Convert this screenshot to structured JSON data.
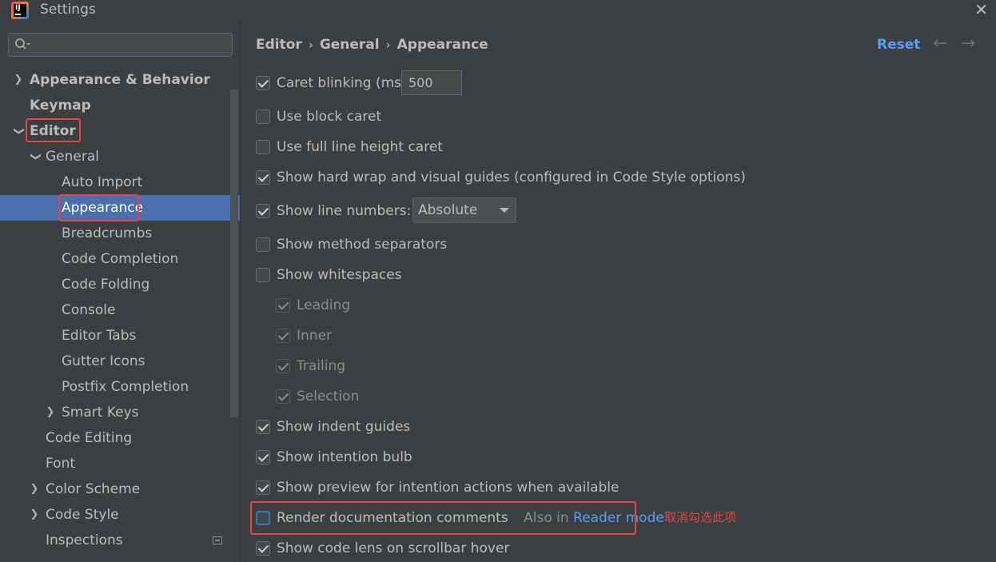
{
  "window": {
    "title": "Settings"
  },
  "search": {
    "placeholder": ""
  },
  "tree": [
    {
      "label": "Appearance & Behavior"
    },
    {
      "label": "Keymap"
    },
    {
      "label": "Editor"
    },
    {
      "label": "General"
    },
    {
      "label": "Auto Import"
    },
    {
      "label": "Appearance"
    },
    {
      "label": "Breadcrumbs"
    },
    {
      "label": "Code Completion"
    },
    {
      "label": "Code Folding"
    },
    {
      "label": "Console"
    },
    {
      "label": "Editor Tabs"
    },
    {
      "label": "Gutter Icons"
    },
    {
      "label": "Postfix Completion"
    },
    {
      "label": "Smart Keys"
    },
    {
      "label": "Code Editing"
    },
    {
      "label": "Font"
    },
    {
      "label": "Color Scheme"
    },
    {
      "label": "Code Style"
    },
    {
      "label": "Inspections"
    }
  ],
  "breadcrumb": [
    "Editor",
    "General",
    "Appearance"
  ],
  "toolbar": {
    "reset": "Reset"
  },
  "options": {
    "caret_blinking": {
      "label": "Caret blinking (ms):",
      "checked": true,
      "value": "500"
    },
    "block_caret": {
      "label": "Use block caret",
      "checked": false
    },
    "full_line_caret": {
      "label": "Use full line height caret",
      "checked": false
    },
    "hard_wrap": {
      "label": "Show hard wrap and visual guides (configured in Code Style options)",
      "checked": true
    },
    "line_numbers": {
      "label": "Show line numbers:",
      "checked": true,
      "value": "Absolute"
    },
    "method_separators": {
      "label": "Show method separators",
      "checked": false
    },
    "whitespaces": {
      "label": "Show whitespaces",
      "checked": false
    },
    "leading": {
      "label": "Leading",
      "checked": true
    },
    "inner": {
      "label": "Inner",
      "checked": true
    },
    "trailing": {
      "label": "Trailing",
      "checked": true
    },
    "selection": {
      "label": "Selection",
      "checked": true
    },
    "indent_guides": {
      "label": "Show indent guides",
      "checked": true
    },
    "intention_bulb": {
      "label": "Show intention bulb",
      "checked": true
    },
    "preview_intention": {
      "label": "Show preview for intention actions when available",
      "checked": true
    },
    "render_docs": {
      "label": "Render documentation comments",
      "checked": false,
      "hint": "Also in",
      "link": "Reader mode"
    },
    "code_lens": {
      "label": "Show code lens on scrollbar hover",
      "checked": true
    }
  },
  "annotation": "取消勾选此项",
  "colors": {
    "accent": "#589df6",
    "selection": "#4b6eaf",
    "highlight": "#e04646"
  }
}
